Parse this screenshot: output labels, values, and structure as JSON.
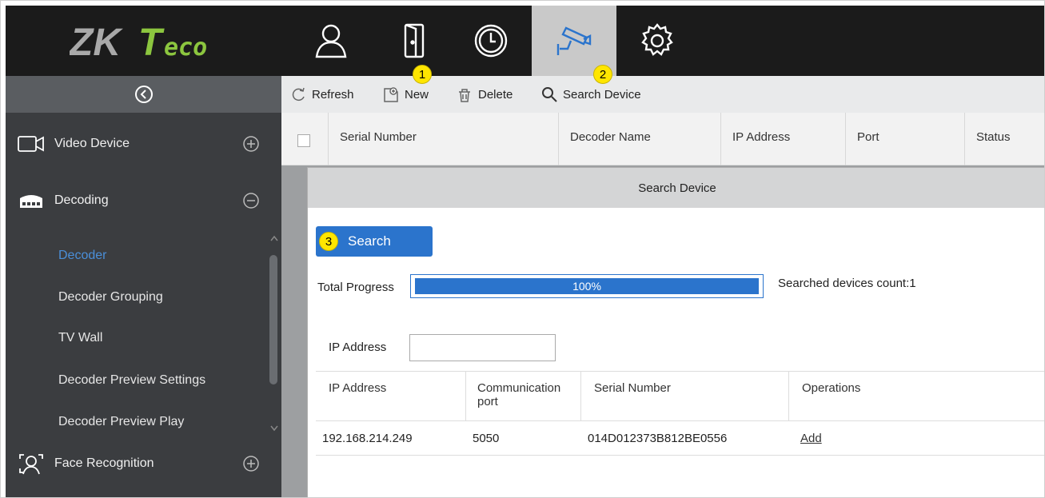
{
  "app": {
    "logo_text": "ZKTeco",
    "nav_icons": [
      "personnel-icon",
      "door-icon",
      "clock-icon",
      "camera-icon",
      "settings-icon"
    ],
    "active_nav": "camera-icon"
  },
  "sidebar": {
    "sections": [
      {
        "label": "Video Device",
        "icon": "video-camera-icon",
        "toggle": "plus-icon"
      },
      {
        "label": "Decoding",
        "icon": "decoder-icon",
        "toggle": "minus-icon"
      },
      {
        "label": "Face Recognition",
        "icon": "face-icon",
        "toggle": "plus-icon"
      }
    ],
    "items": [
      {
        "label": "Decoder",
        "active": true
      },
      {
        "label": "Decoder Grouping"
      },
      {
        "label": "TV Wall"
      },
      {
        "label": "Decoder Preview Settings"
      },
      {
        "label": "Decoder Preview Play"
      }
    ]
  },
  "toolbar": {
    "refresh": "Refresh",
    "new": "New",
    "delete": "Delete",
    "search_device": "Search Device"
  },
  "badges": [
    "1",
    "2",
    "3"
  ],
  "grid": {
    "columns": [
      "Serial Number",
      "Decoder Name",
      "IP Address",
      "Port",
      "Status"
    ]
  },
  "dialog": {
    "title": "Search Device",
    "search_button": "Search",
    "total_progress_label": "Total Progress",
    "progress_value": 1.0,
    "progress_text": "100%",
    "searched_count": "Searched devices count:1",
    "ip_label": "IP Address",
    "ip_value": "",
    "table": {
      "columns": [
        "IP Address",
        "Communication port",
        "Serial Number",
        "Operations"
      ],
      "rows": [
        {
          "ip": "192.168.214.249",
          "port": "5050",
          "serial": "014D012373B812BE0556",
          "operation": "Add"
        }
      ]
    }
  },
  "colors": {
    "accent": "#2b74cc",
    "sidebar_bg": "#3b3d40",
    "active_item": "#4a8fd9",
    "badge": "#ffe600"
  }
}
